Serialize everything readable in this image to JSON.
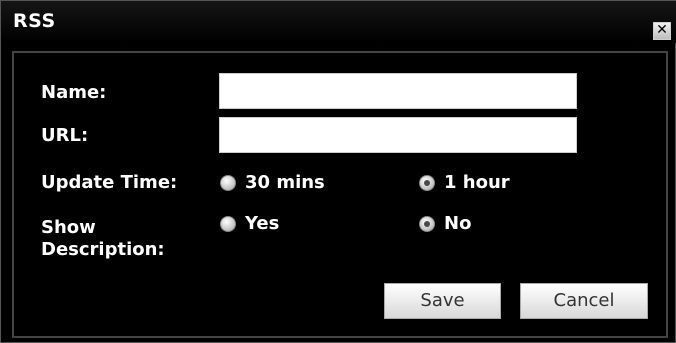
{
  "dialog": {
    "title": "RSS",
    "close_icon": "close-icon"
  },
  "form": {
    "name_label": "Name:",
    "name_value": "",
    "url_label": "URL:",
    "url_value": "",
    "update_time_label": "Update Time:",
    "update_time_options": [
      "30 mins",
      "1 hour"
    ],
    "update_time_selected": "1 hour",
    "show_description_label_line1": "Show",
    "show_description_label_line2": "Description:",
    "show_description_options": [
      "Yes",
      "No"
    ],
    "show_description_selected": "No"
  },
  "buttons": {
    "save_label": "Save",
    "cancel_label": "Cancel"
  }
}
